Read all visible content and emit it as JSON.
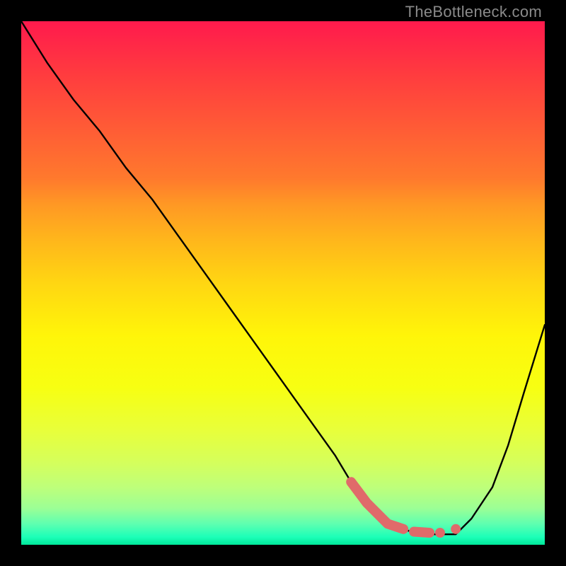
{
  "watermark": "TheBottleneck.com",
  "chart_data": {
    "type": "line",
    "title": "",
    "xlabel": "",
    "ylabel": "",
    "xlim": [
      0,
      100
    ],
    "ylim": [
      0,
      100
    ],
    "grid": false,
    "series": [
      {
        "name": "bottleneck-curve",
        "color": "#000000",
        "x": [
          0,
          5,
          10,
          15,
          20,
          25,
          30,
          35,
          40,
          45,
          50,
          55,
          60,
          63,
          66,
          70,
          73,
          76,
          80,
          83,
          86,
          90,
          93,
          96,
          100
        ],
        "y": [
          100,
          92,
          85,
          79,
          72,
          66,
          59,
          52,
          45,
          38,
          31,
          24,
          17,
          12,
          8,
          4,
          3,
          2,
          2,
          2,
          5,
          11,
          19,
          29,
          42
        ]
      }
    ],
    "highlight": {
      "name": "best-match-segment",
      "color": "#e06a6a",
      "segments": [
        {
          "x": [
            63,
            66,
            70,
            73
          ],
          "y": [
            12,
            8,
            4,
            3
          ]
        },
        {
          "x": [
            75,
            78
          ],
          "y": [
            2.5,
            2.3
          ]
        }
      ],
      "dots": [
        {
          "x": 80,
          "y": 2.3
        },
        {
          "x": 83,
          "y": 3.0
        }
      ]
    },
    "background_gradient": {
      "top": "#ff1a4d",
      "middle": "#fff509",
      "bottom": "#00e89a"
    }
  }
}
